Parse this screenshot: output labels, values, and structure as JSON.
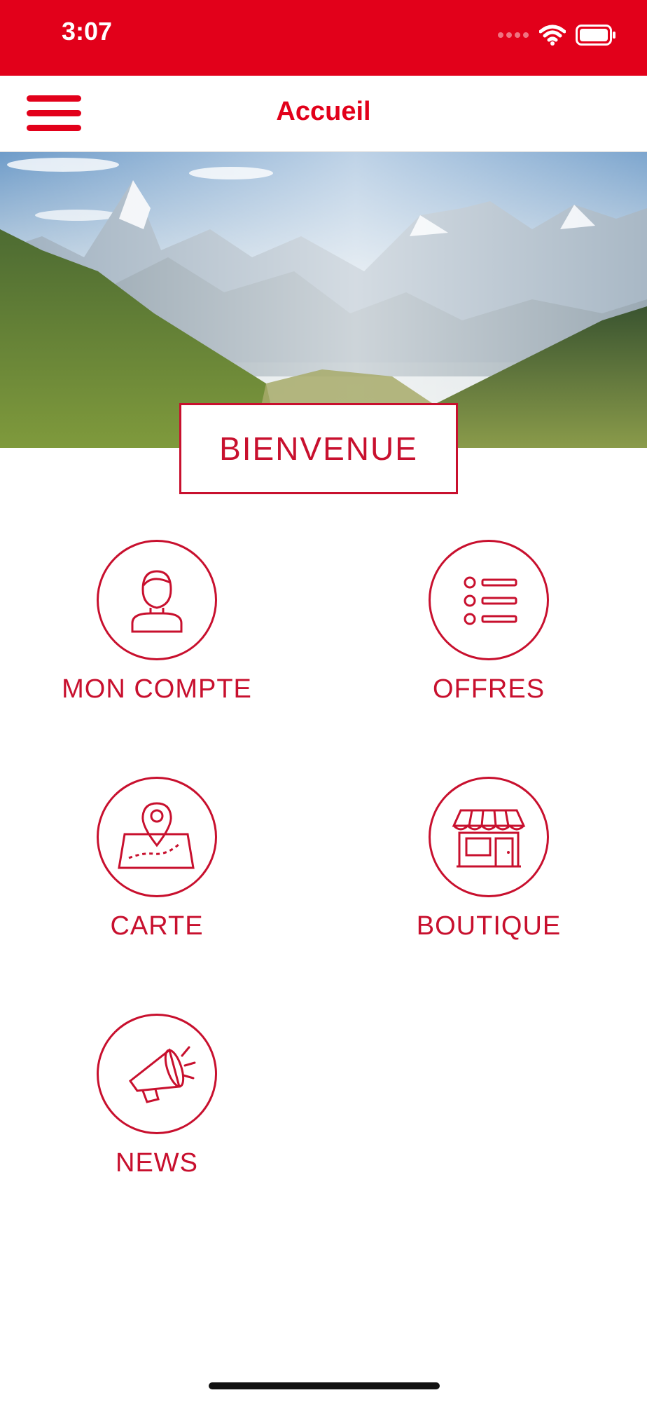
{
  "status_bar": {
    "time": "3:07"
  },
  "nav": {
    "title": "Accueil",
    "menu_icon": "hamburger-icon"
  },
  "hero": {
    "welcome_label": "BIENVENUE"
  },
  "tiles": [
    {
      "label": "MON COMPTE",
      "icon": "user-icon"
    },
    {
      "label": "OFFRES",
      "icon": "list-icon"
    },
    {
      "label": "CARTE",
      "icon": "map-pin-icon"
    },
    {
      "label": "BOUTIQUE",
      "icon": "store-icon"
    },
    {
      "label": "NEWS",
      "icon": "megaphone-icon"
    }
  ],
  "colors": {
    "brand": "#e2001a",
    "accent": "#c8102e"
  }
}
